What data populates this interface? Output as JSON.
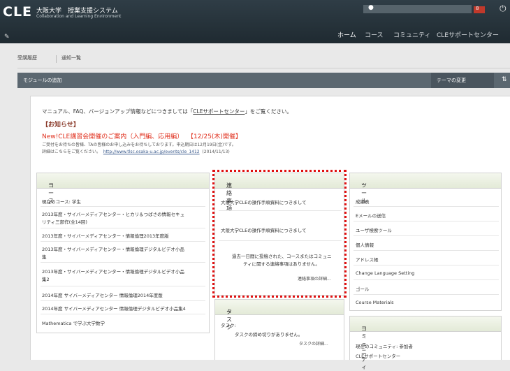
{
  "header": {
    "logo": "CLE",
    "title": "大阪大学　授業支援システム",
    "subtitle": "Collaboration and Learning Environment",
    "user": "▲",
    "alert_count": "8",
    "nav": [
      "ホーム",
      "コース",
      "コミュニティ",
      "CLEサポートセンター"
    ]
  },
  "tabs": [
    "受講履歴",
    "通知一覧"
  ],
  "module_bar": {
    "left": "モジュールの追加",
    "theme": "テーマの変更",
    "sort_icon": "⇅"
  },
  "notice": {
    "prefix": "マニュアル、FAQ、バージョンアップ情報などにつきましては「",
    "link": "CLEサポートセンター",
    "suffix": "」をご覧ください。"
  },
  "news": {
    "heading": "【お知らせ】",
    "new_label": "New!",
    "title": "CLE講習会開催のご案内（入門編、応用編）",
    "date": "【12/25(木)開催】",
    "line2": "ご受付をお待ちの皆様、TAの皆様のお申し込みをお待ちしております。申込期日は12月19日(金)です。",
    "line3_prefix": "詳細はこちらをご覧ください。",
    "line3_link": "http://www.tlsc.osaka-u.ac.jp/events/cle_1412",
    "line3_suffix": "(2014/11/13)"
  },
  "courses": {
    "header": "コース",
    "items": [
      "現在のコース: 学生",
      "2013年度・サイバーメディアセンター・ヒカリ＆つばさの情報セキュ",
      "リティ三部作(全14回)",
      "2013年度・サイバーメディアセンター・情報倫理2013年度版",
      "2013年度・サイバーメディアセンター・情報倫理デジタルビデオ小品",
      "集",
      "2013年度・サイバーメディアセンター・情報倫理デジタルビデオ小品",
      "集2",
      "2014年度 サイバーメディアセンター 情報倫理2014年度版",
      "2014年度 サイバーメディアセンター 情報倫理デジタルビデオ小品集4",
      "Mathematica で学ぶ大学数学"
    ]
  },
  "messages": {
    "header": "連絡事項",
    "items": [
      "大阪大学CLEの操作手順資料につきまして",
      "大阪大学CLEの操作手順資料につきまして"
    ],
    "empty_1": "過去一日間に投稿された、コースまたはコミュニ",
    "empty_2": "ティに関する連絡事項はありません。",
    "more": "連絡事項の詳細..."
  },
  "tasks": {
    "header": "タスク",
    "label": "タスク:",
    "empty": "タスクの締め切りがありません。",
    "more": "タスクの詳細..."
  },
  "tools": {
    "header": "ツール",
    "items": [
      "成績表",
      "Eメールの送信",
      "ユーザ検索ツール",
      "個人情報",
      "アドレス帳",
      "Change Language Setting",
      "ゴール",
      "Course Materials"
    ]
  },
  "community": {
    "header": "コミュニティ",
    "line1": "現在のコミュニティ: 参加者",
    "line2": "CLEサポートセンター"
  },
  "icons": {
    "power": "⏻",
    "pencil": "✎",
    "user": "●",
    "collapse": "−"
  }
}
